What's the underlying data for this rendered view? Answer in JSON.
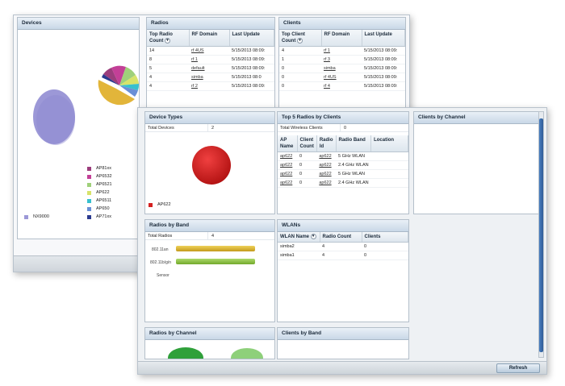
{
  "devices": {
    "title": "Devices",
    "legend": [
      {
        "label": "AP81xx",
        "color": "#9b3d7c"
      },
      {
        "label": "AP6532",
        "color": "#c33f97"
      },
      {
        "label": "AP6521",
        "color": "#9fd07a"
      },
      {
        "label": "AP622",
        "color": "#d7e36a"
      },
      {
        "label": "AP6511",
        "color": "#37c0cf"
      },
      {
        "label": "AP650",
        "color": "#6a8fd6"
      },
      {
        "label": "AP71xx",
        "color": "#2b3a8f"
      }
    ],
    "legend_left": {
      "label": "NX9000",
      "color": "#9c98d7"
    }
  },
  "radios": {
    "title": "Radios",
    "headers": [
      "Top Radio Count",
      "RF Domain",
      "Last Update"
    ],
    "rows": [
      [
        "14",
        "rf 4US",
        "5/15/2013 08:09:"
      ],
      [
        "8",
        "rf 1",
        "5/15/2013 08:09:"
      ],
      [
        "5",
        "default",
        "5/15/2013 08:09:"
      ],
      [
        "4",
        "simba",
        "5/15/2013 08:0"
      ],
      [
        "4",
        "rf 2",
        "5/15/2013 08:09:"
      ]
    ]
  },
  "clients": {
    "title": "Clients",
    "headers": [
      "Top Client Count",
      "RF Domain",
      "Last Update"
    ],
    "rows": [
      [
        "4",
        "rf 1",
        "5/15/2013 08:09:"
      ],
      [
        "1",
        "rf 3",
        "5/15/2013 08:09:"
      ],
      [
        "0",
        "simba",
        "5/15/2013 08:09:"
      ],
      [
        "0",
        "rf 4US",
        "5/15/2013 08:09:"
      ],
      [
        "0",
        "rf 4",
        "5/15/2013 08:09:"
      ]
    ]
  },
  "device_types": {
    "title": "Device Types",
    "total_label": "Total Devices",
    "total_value": "2",
    "legend": {
      "label": "AP622",
      "color": "#d42020"
    }
  },
  "top5": {
    "title": "Top 5 Radios by Clients",
    "total_label": "Total Wireless Clients",
    "total_value": "0",
    "headers": [
      "AP Name",
      "Client Count",
      "Radio Id",
      "Radio Band",
      "Location"
    ],
    "rows": [
      [
        "ap622",
        "0",
        "ap622",
        "5 GHz WLAN",
        ""
      ],
      [
        "ap622",
        "0",
        "ap622",
        "2.4 GHz WLAN",
        ""
      ],
      [
        "ap622",
        "0",
        "ap622",
        "5 GHz WLAN",
        ""
      ],
      [
        "ap622",
        "0",
        "ap622",
        "2.4 GHz WLAN",
        ""
      ]
    ]
  },
  "clients_by_channel": {
    "title": "Clients by Channel"
  },
  "radios_by_band": {
    "title": "Radios by Band",
    "total_label": "Total Radios",
    "total_value": "4",
    "bars": [
      {
        "label": "802.11an",
        "color": "#d8b42a",
        "value": 2
      },
      {
        "label": "802.11b/g/n",
        "color": "#8cc43f",
        "value": 2
      }
    ],
    "sensor_label": "Sensor"
  },
  "wlans": {
    "title": "WLANs",
    "headers": [
      "WLAN Name",
      "Radio Count",
      "Clients"
    ],
    "rows": [
      [
        "simba2",
        "4",
        "0"
      ],
      [
        "simba1",
        "4",
        "0"
      ]
    ]
  },
  "radios_by_channel": {
    "title": "Radios by Channel"
  },
  "clients_by_band": {
    "title": "Clients by Band"
  },
  "footer": {
    "refresh_label": "Refresh"
  }
}
